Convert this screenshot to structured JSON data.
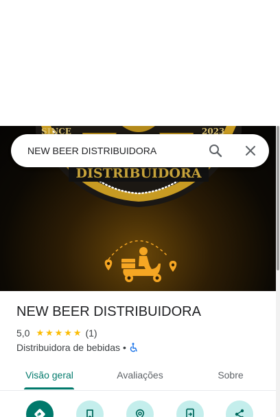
{
  "search": {
    "value": "NEW BEER DISTRIBUIDORA",
    "search_icon": "search-icon",
    "close_icon": "close-icon"
  },
  "hero": {
    "logo_text_left": "SINCE",
    "logo_text_right": "2023",
    "logo_banner": "DISTRIBUIDORA",
    "illustration": "delivery-scooter-icon",
    "colors": {
      "gold": "#f5a623",
      "dark": "#0c0904",
      "logo_text": "#c8a43a"
    }
  },
  "place": {
    "title": "NEW BEER DISTRIBUIDORA",
    "rating_value": "5,0",
    "stars": 5,
    "review_count": "(1)",
    "category": "Distribuidora de bebidas",
    "separator": "•",
    "accessibility_icon": "wheelchair-icon"
  },
  "tabs": [
    {
      "label": "Visão geral",
      "active": true
    },
    {
      "label": "Avaliações",
      "active": false
    },
    {
      "label": "Sobre",
      "active": false
    }
  ],
  "actions": [
    {
      "icon": "directions-icon"
    },
    {
      "icon": "bookmark-icon"
    },
    {
      "icon": "nearby-icon"
    },
    {
      "icon": "send-to-phone-icon"
    },
    {
      "icon": "share-icon"
    }
  ],
  "colors": {
    "accent": "#00796b",
    "accent_light": "#c4eeec",
    "star": "#fbbc04",
    "text": "#202124",
    "secondary_text": "#3c4043",
    "accessibility": "#1a73e8"
  }
}
